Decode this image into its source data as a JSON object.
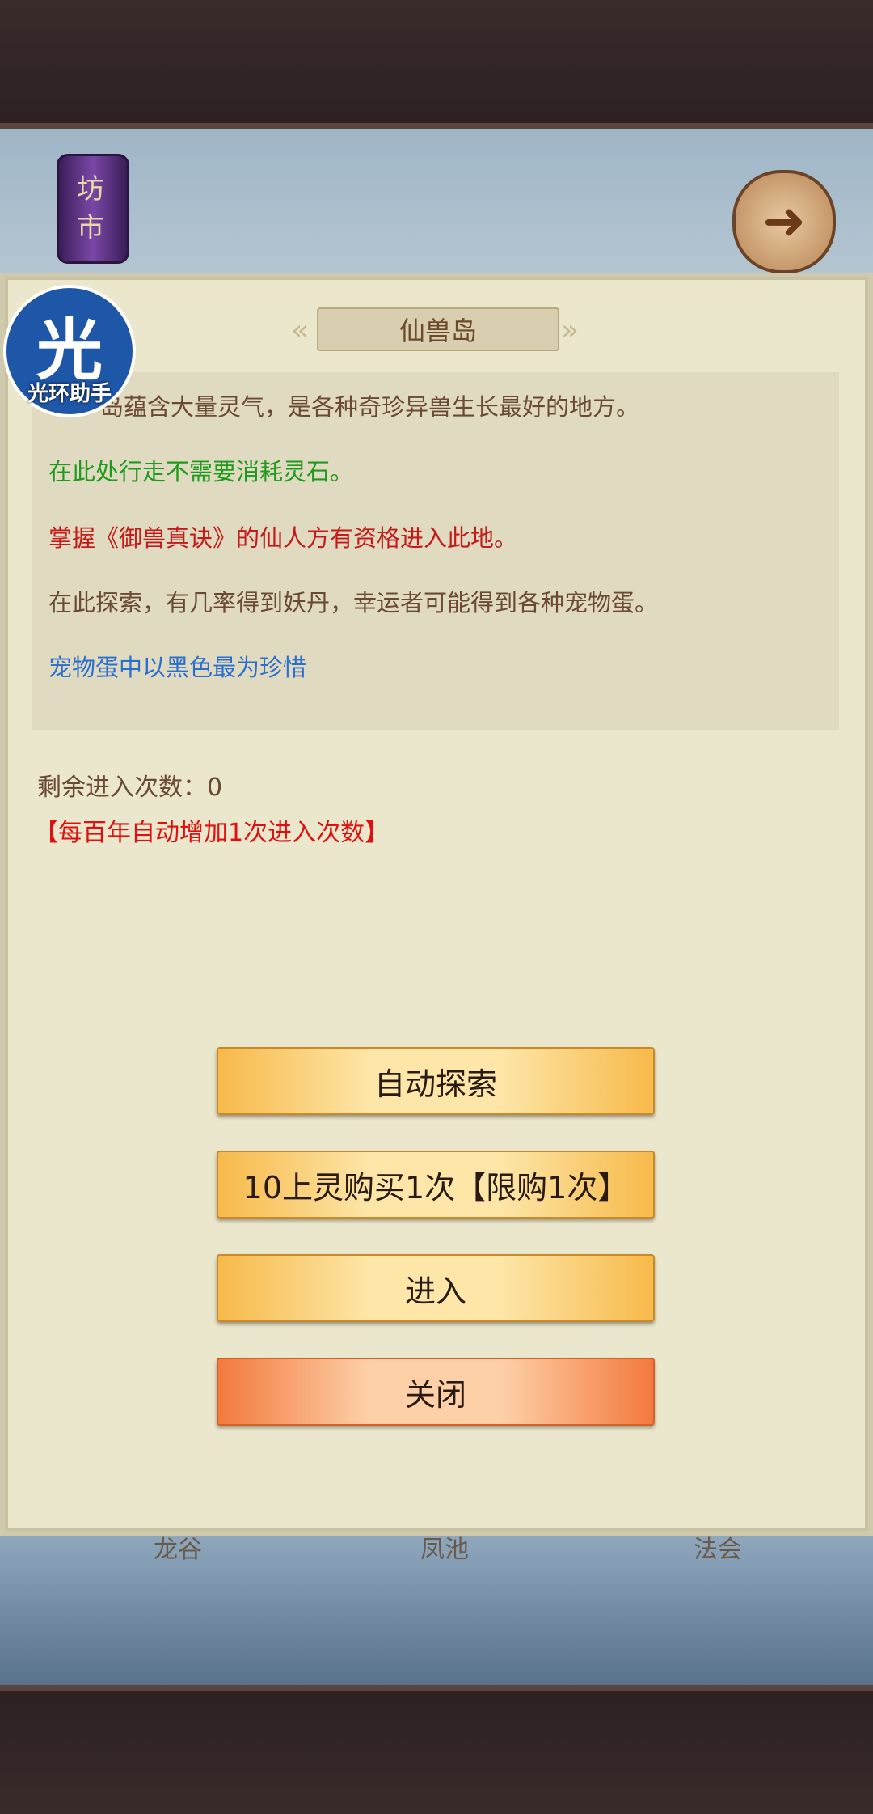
{
  "header": {
    "lantern_text": "坊市",
    "back_icon": "back-arrow-icon"
  },
  "panel": {
    "title": "仙兽岛",
    "description": [
      {
        "text": "岛蕴含大量灵气，是各种奇珍异兽生长最好的地方。",
        "color": "#6b4a35"
      },
      {
        "text": "在此处行走不需要消耗灵石。",
        "color": "#1e9a1e"
      },
      {
        "text": "掌握《御兽真诀》的仙人方有资格进入此地。",
        "color": "#c41a1a"
      },
      {
        "text": "在此探索，有几率得到妖丹，幸运者可能得到各种宠物蛋。",
        "color": "#6b4a35"
      },
      {
        "text": "宠物蛋中以黑色最为珍惜",
        "color": "#2a6ed0"
      }
    ],
    "remaining_label": "剩余进入次数：0",
    "remaining_note": "【每百年自动增加1次进入次数】"
  },
  "overlay_logo": {
    "char": "光",
    "text": "光环助手"
  },
  "buttons": {
    "auto_explore": "自动探索",
    "buy_once": "10上灵购买1次【限购1次】",
    "enter": "进入",
    "close": "关闭"
  },
  "bottom_tabs": [
    "龙谷",
    "凤池",
    "法会"
  ]
}
